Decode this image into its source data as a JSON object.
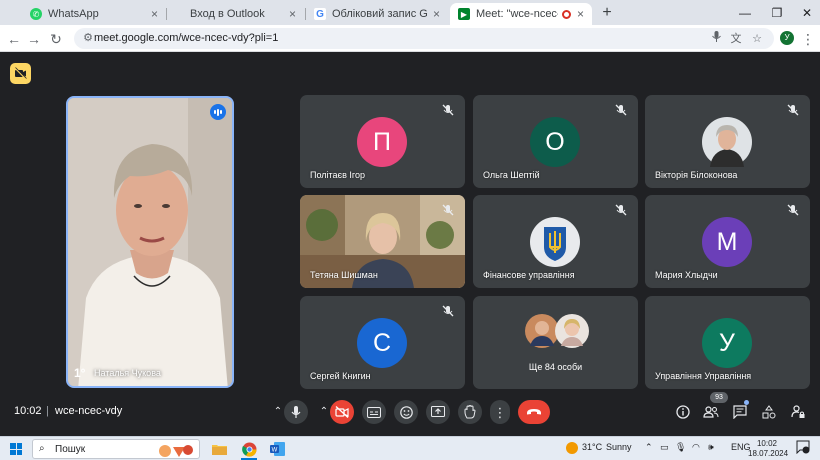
{
  "browser": {
    "tabs": [
      {
        "label": "WhatsApp",
        "icon": "whatsapp-icon",
        "color": "#25d366"
      },
      {
        "label": "Вход в Outlook",
        "icon": "microsoft-icon",
        "color": "#f25022"
      },
      {
        "label": "Обліковий запис Google",
        "icon": "google-icon",
        "color": "#4285f4"
      },
      {
        "label": "Meet: \"wce-ncec-vdy\"",
        "icon": "meet-icon",
        "color": "#00832d"
      }
    ],
    "url": "meet.google.com/wce-ncec-vdy?pli=1",
    "profile_initial": "У"
  },
  "meeting": {
    "speaker_name": "Наталья Чукова",
    "participants": [
      {
        "name": "Політаєв Ігор",
        "initial": "П",
        "color": "#e8467c"
      },
      {
        "name": "Ольга Шептій",
        "initial": "О",
        "color": "#0d5c4b"
      },
      {
        "name": "Вікторія Білоконова",
        "initial": "",
        "color": "#cfd4d8"
      },
      {
        "name": "Тетяна Шишман",
        "initial": "",
        "color": "#8a7a62"
      },
      {
        "name": "Фінансове управління",
        "initial": "",
        "color": "#1f5aa8"
      },
      {
        "name": "Мария Хлыдчи",
        "initial": "М",
        "color": "#6b3fb8"
      },
      {
        "name": "Сергей Книгин",
        "initial": "С",
        "color": "#1967d2"
      },
      {
        "name": "Ще 84 особи",
        "initial": "",
        "color": "#3c4043"
      },
      {
        "name": "Управління Управління",
        "initial": "У",
        "color": "#0d7a5f"
      }
    ],
    "time": "10:02",
    "separator": "|",
    "code": "wce-ncec-vdy",
    "participant_count": "93",
    "accent": "#8ab4f8",
    "end_call_color": "#ea4335"
  },
  "taskbar": {
    "search_placeholder": "Пошук",
    "temperature": "31°C",
    "weather": "Sunny",
    "language": "ENG",
    "time": "10:02",
    "date": "18.07.2024"
  }
}
